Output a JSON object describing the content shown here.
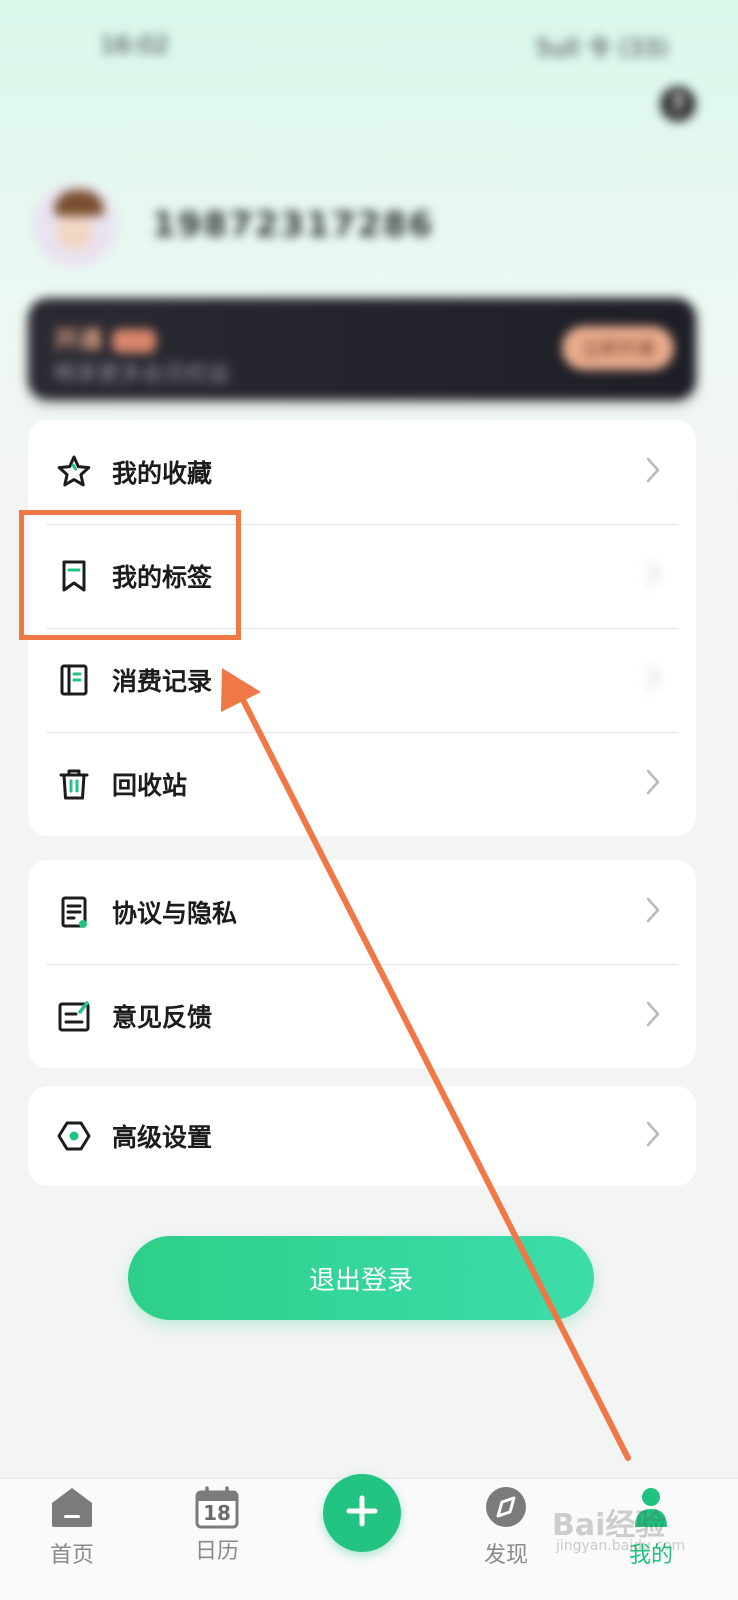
{
  "status_bar": {
    "time": "16:02",
    "indicators": "5ull 令 (33)"
  },
  "header": {
    "help_icon": "help-icon",
    "help_glyph": "?"
  },
  "profile": {
    "phone": "19872317286",
    "avatar": "avatar-image"
  },
  "vip_card": {
    "title": "开通",
    "subtitle": "畅享更多会员权益",
    "cta": "立即开通"
  },
  "menu_groups": [
    {
      "items": [
        {
          "label": "我的收藏",
          "icon": "star-icon"
        },
        {
          "label": "我的标签",
          "icon": "bookmark-icon"
        },
        {
          "label": "消费记录",
          "icon": "notebook-icon"
        },
        {
          "label": "回收站",
          "icon": "trash-icon"
        }
      ]
    },
    {
      "items": [
        {
          "label": "协议与隐私",
          "icon": "document-icon"
        },
        {
          "label": "意见反馈",
          "icon": "feedback-icon"
        }
      ]
    },
    {
      "items": [
        {
          "label": "高级设置",
          "icon": "hexagon-settings-icon"
        }
      ]
    }
  ],
  "logout": {
    "label": "退出登录"
  },
  "tab_bar": {
    "tabs": [
      {
        "label": "首页",
        "icon": "home-icon"
      },
      {
        "label": "日历",
        "icon": "calendar-icon",
        "badge": "18"
      },
      {
        "label": "发现",
        "icon": "compass-icon"
      },
      {
        "label": "我的",
        "icon": "profile-icon",
        "active": true
      }
    ],
    "add_icon": "plus-icon"
  },
  "annotation": {
    "highlight_target": "我的标签",
    "color": "#f07846"
  },
  "watermark": {
    "text": "Bai经验",
    "sub": "jingyan.baidu.com"
  },
  "colors": {
    "accent": "#23c483",
    "annotation": "#f07846",
    "vip_text": "#e3a585"
  }
}
